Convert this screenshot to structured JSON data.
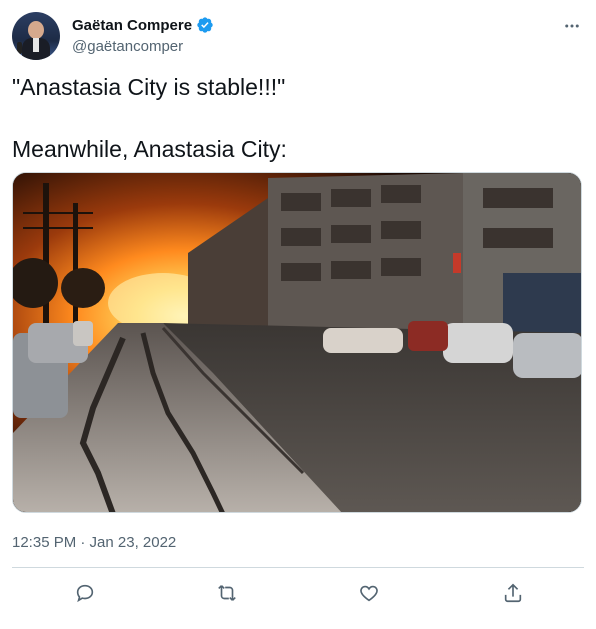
{
  "author": {
    "name": "Gaëtan Compere",
    "handle": "@gaëtancomper",
    "verified": true
  },
  "tweet": {
    "line1": "\"Anastasia City is stable!!!\"",
    "line2": "Meanwhile, Anastasia City:",
    "timestamp": "12:35 PM · Jan 23, 2022"
  },
  "icons": {
    "more": "more-options-icon",
    "reply": "reply-icon",
    "retweet": "retweet-icon",
    "like": "like-icon",
    "share": "share-icon",
    "verified": "verified-badge-icon"
  },
  "colors": {
    "text": "#0f1419",
    "secondary": "#536471",
    "verified": "#1d9bf0",
    "divider": "#cfd9de"
  }
}
